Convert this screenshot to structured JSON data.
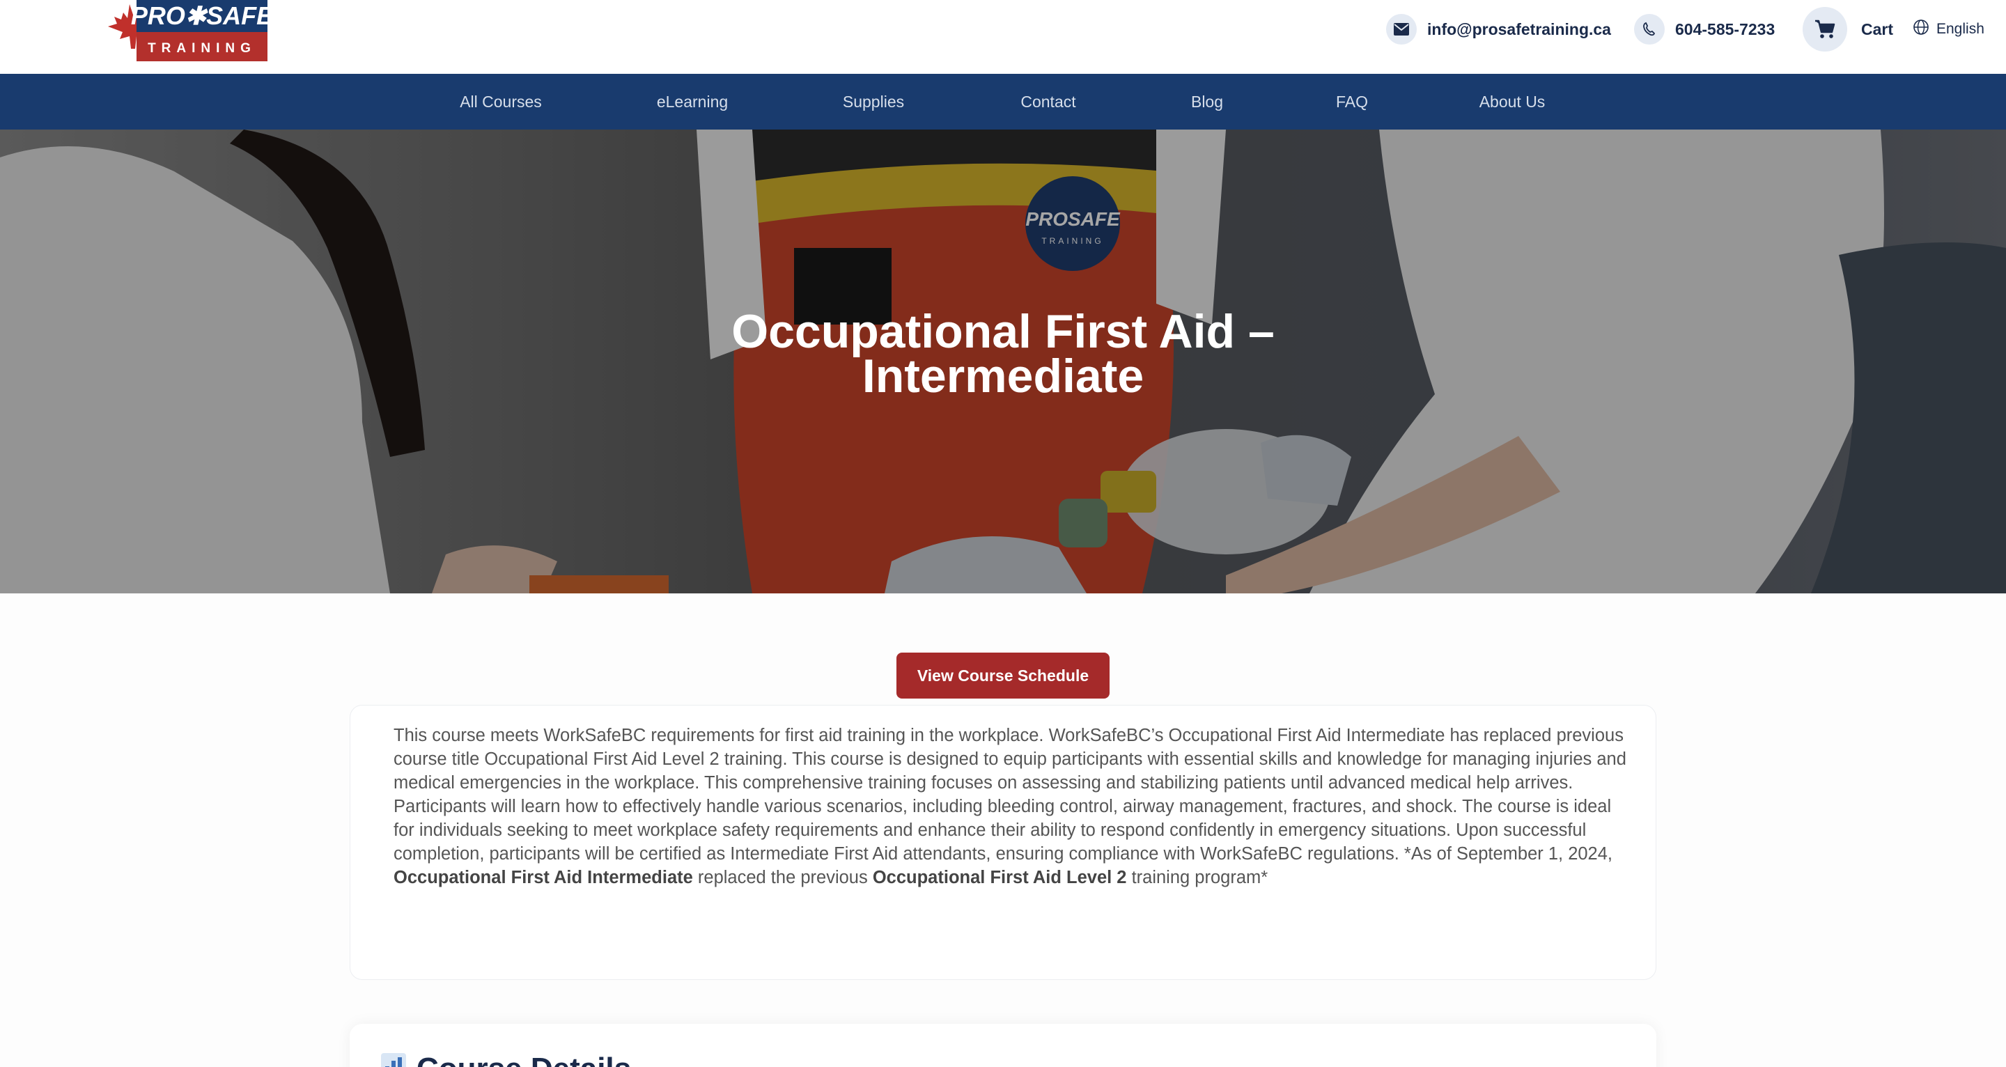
{
  "brand": {
    "logo_top": "PROSAFE",
    "logo_bottom": "TRAINING",
    "colors": {
      "navy": "#193b6e",
      "red": "#a52a2a"
    }
  },
  "header": {
    "email": "info@prosafetraining.ca",
    "phone": "604-585-7233",
    "cart_label": "Cart",
    "language": "English",
    "icons": [
      "envelope-icon",
      "phone-icon",
      "cart-icon",
      "globe-icon"
    ]
  },
  "nav": {
    "items": [
      {
        "label": "All Courses"
      },
      {
        "label": "eLearning"
      },
      {
        "label": "Supplies"
      },
      {
        "label": "Contact"
      },
      {
        "label": "Blog"
      },
      {
        "label": "FAQ"
      },
      {
        "label": "About Us"
      }
    ]
  },
  "hero": {
    "title_line1": "Occupational First Aid –",
    "title_line2": "Intermediate",
    "vest_badge_top": "PROSAFE",
    "vest_badge_bottom": "TRAINING"
  },
  "schedule_button": {
    "label": "View Course Schedule"
  },
  "description": {
    "body": "This course meets WorkSafeBC requirements for first aid training in the workplace. WorkSafeBC’s Occupational First Aid Intermediate has replaced previous course title Occupational First Aid Level 2 training. This course is designed to equip participants with essential skills and knowledge for managing injuries and medical emergencies in the workplace. This comprehensive training focuses on assessing and stabilizing patients until advanced medical help arrives. Participants will learn how to effectively handle various scenarios, including bleeding control, airway management, fractures, and shock. The course is ideal for individuals seeking to meet workplace safety requirements and enhance their ability to respond confidently in emergency situations. Upon successful completion, participants will be certified as Intermediate First Aid attendants, ensuring compliance with WorkSafeBC regulations. *As of September 1, 2024,",
    "bold1": "Occupational First Aid Intermediate",
    "middle": "replaced the previous",
    "bold2": "Occupational First Aid Level 2",
    "tail": "training program*"
  },
  "details": {
    "heading": "Course Details",
    "icon": "bar-chart-icon"
  }
}
